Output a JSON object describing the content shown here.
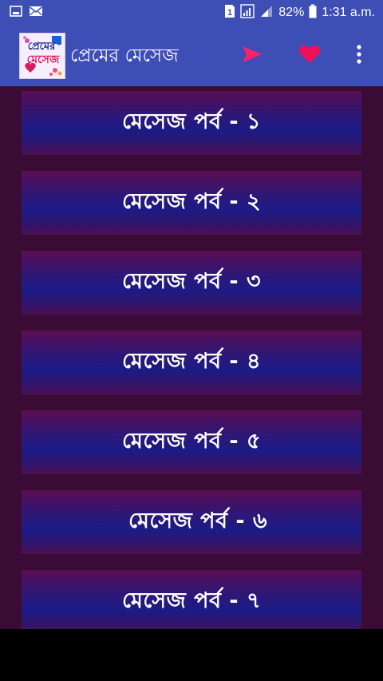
{
  "status_bar": {
    "battery_percent": "82%",
    "time": "1:31 a.m.",
    "sim_label": "1",
    "icons": [
      "gallery-icon",
      "mail-icon",
      "sim-icon",
      "signal-icon",
      "battery-icon"
    ]
  },
  "app_bar": {
    "logo_line1": "প্রেমের",
    "logo_line2": "মেসেজ",
    "title": "প্রেমের মেসেজ",
    "actions": [
      "share-icon",
      "favorite-heart-icon",
      "more-vert-icon"
    ]
  },
  "colors": {
    "app_bar": "#3e4eb7",
    "status_bar": "#3d4fb4",
    "content_bg": "#3a0b35",
    "share": "#ff1f6b",
    "heart": "#f0105a"
  },
  "items": [
    {
      "label": "মেসেজ পর্ব - ১"
    },
    {
      "label": "মেসেজ পর্ব - ২"
    },
    {
      "label": "মেসেজ পর্ব - ৩"
    },
    {
      "label": "মেসেজ পর্ব - ৪"
    },
    {
      "label": "মেসেজ পর্ব - ৫"
    },
    {
      "label": "মেসেজ পর্ব - ৬"
    },
    {
      "label": "মেসেজ পর্ব - ৭"
    }
  ]
}
